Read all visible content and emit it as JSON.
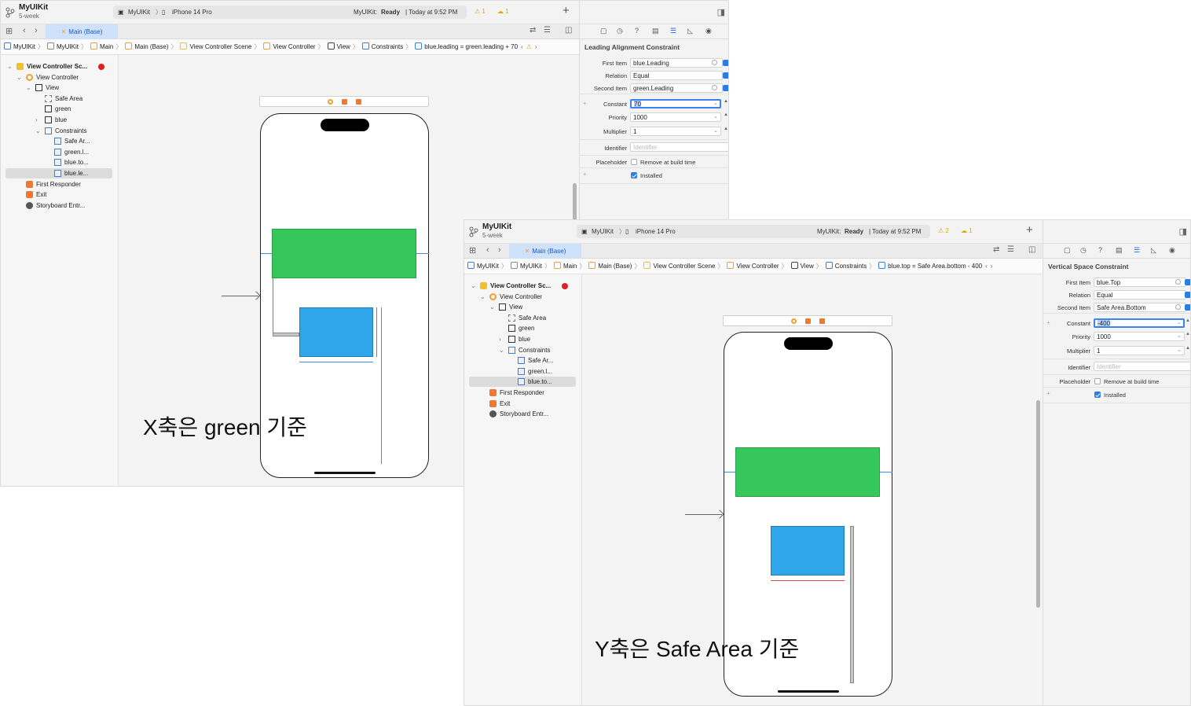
{
  "windows": [
    {
      "project": {
        "title": "MyUIKit",
        "subtitle": "5-week"
      },
      "scheme": {
        "app": "MyUIKit",
        "device": "iPhone 14 Pro",
        "status_prefix": "MyUIKit:",
        "status_ready": "Ready",
        "status_time": "| Today at 9:52 PM",
        "warnings": "1",
        "issues": "1"
      },
      "tab": {
        "label": "Main (Base)"
      },
      "breadcrumbs": [
        "MyUIKit",
        "MyUIKit",
        "Main",
        "Main (Base)",
        "View Controller Scene",
        "View Controller",
        "View",
        "Constraints",
        "blue.leading = green.leading + 70"
      ],
      "jump_warning": "⚠",
      "outline": [
        {
          "label": "View Controller Sc...",
          "depth": 0
        },
        {
          "label": "View Controller",
          "depth": 1
        },
        {
          "label": "View",
          "depth": 2
        },
        {
          "label": "Safe Area",
          "depth": 3
        },
        {
          "label": "green",
          "depth": 3
        },
        {
          "label": "blue",
          "depth": 3
        },
        {
          "label": "Constraints",
          "depth": 3
        },
        {
          "label": "Safe Ar...",
          "depth": 4
        },
        {
          "label": "green.l...",
          "depth": 4
        },
        {
          "label": "blue.to...",
          "depth": 4
        },
        {
          "label": "blue.le...",
          "depth": 4
        },
        {
          "label": "First Responder",
          "depth": 1
        },
        {
          "label": "Exit",
          "depth": 1
        },
        {
          "label": "Storyboard Entr...",
          "depth": 1
        }
      ],
      "selected_outline": 10,
      "caption": "X축은 green 기준",
      "inspector": {
        "title": "Leading Alignment Constraint",
        "first_item_label": "First Item",
        "first_item": "blue.Leading",
        "relation_label": "Relation",
        "relation": "Equal",
        "second_item_label": "Second Item",
        "second_item": "green.Leading",
        "constant_label": "Constant",
        "constant": "70",
        "priority_label": "Priority",
        "priority": "1000",
        "multiplier_label": "Multiplier",
        "multiplier": "1",
        "identifier_label": "Identifier",
        "identifier_placeholder": "Identifier",
        "placeholder_label": "Placeholder",
        "placeholder_option": "Remove at build time",
        "installed_label": "Installed"
      }
    },
    {
      "project": {
        "title": "MyUIKit",
        "subtitle": "5-week"
      },
      "scheme": {
        "app": "MyUIKit",
        "device": "iPhone 14 Pro",
        "status_prefix": "MyUIKit:",
        "status_ready": "Ready",
        "status_time": "| Today at 9:52 PM",
        "warnings": "2",
        "issues": "1"
      },
      "tab": {
        "label": "Main (Base)"
      },
      "breadcrumbs": [
        "MyUIKit",
        "MyUIKit",
        "Main",
        "Main (Base)",
        "View Controller Scene",
        "View Controller",
        "View",
        "Constraints",
        "blue.top = Safe Area.bottom - 400"
      ],
      "outline": [
        {
          "label": "View Controller Sc...",
          "depth": 0
        },
        {
          "label": "View Controller",
          "depth": 1
        },
        {
          "label": "View",
          "depth": 2
        },
        {
          "label": "Safe Area",
          "depth": 3
        },
        {
          "label": "green",
          "depth": 3
        },
        {
          "label": "blue",
          "depth": 3
        },
        {
          "label": "Constraints",
          "depth": 3
        },
        {
          "label": "Safe Ar...",
          "depth": 4
        },
        {
          "label": "green.l...",
          "depth": 4
        },
        {
          "label": "blue.to...",
          "depth": 4
        },
        {
          "label": "First Responder",
          "depth": 1
        },
        {
          "label": "Exit",
          "depth": 1
        },
        {
          "label": "Storyboard Entr...",
          "depth": 1
        }
      ],
      "selected_outline": 9,
      "caption": "Y축은 Safe Area 기준",
      "inspector": {
        "title": "Vertical Space Constraint",
        "first_item_label": "First Item",
        "first_item": "blue.Top",
        "relation_label": "Relation",
        "relation": "Equal",
        "second_item_label": "Second Item",
        "second_item": "Safe Area.Bottom",
        "constant_label": "Constant",
        "constant": "-400",
        "priority_label": "Priority",
        "priority": "1000",
        "multiplier_label": "Multiplier",
        "multiplier": "1",
        "identifier_label": "Identifier",
        "identifier_placeholder": "Identifier",
        "placeholder_label": "Placeholder",
        "placeholder_option": "Remove at build time",
        "installed_label": "Installed"
      }
    }
  ],
  "colors": {
    "green_view": "#35c759",
    "blue_view": "#2fa6e9",
    "constraint": "#3a8ee6",
    "selection": "#cfe2fb"
  }
}
